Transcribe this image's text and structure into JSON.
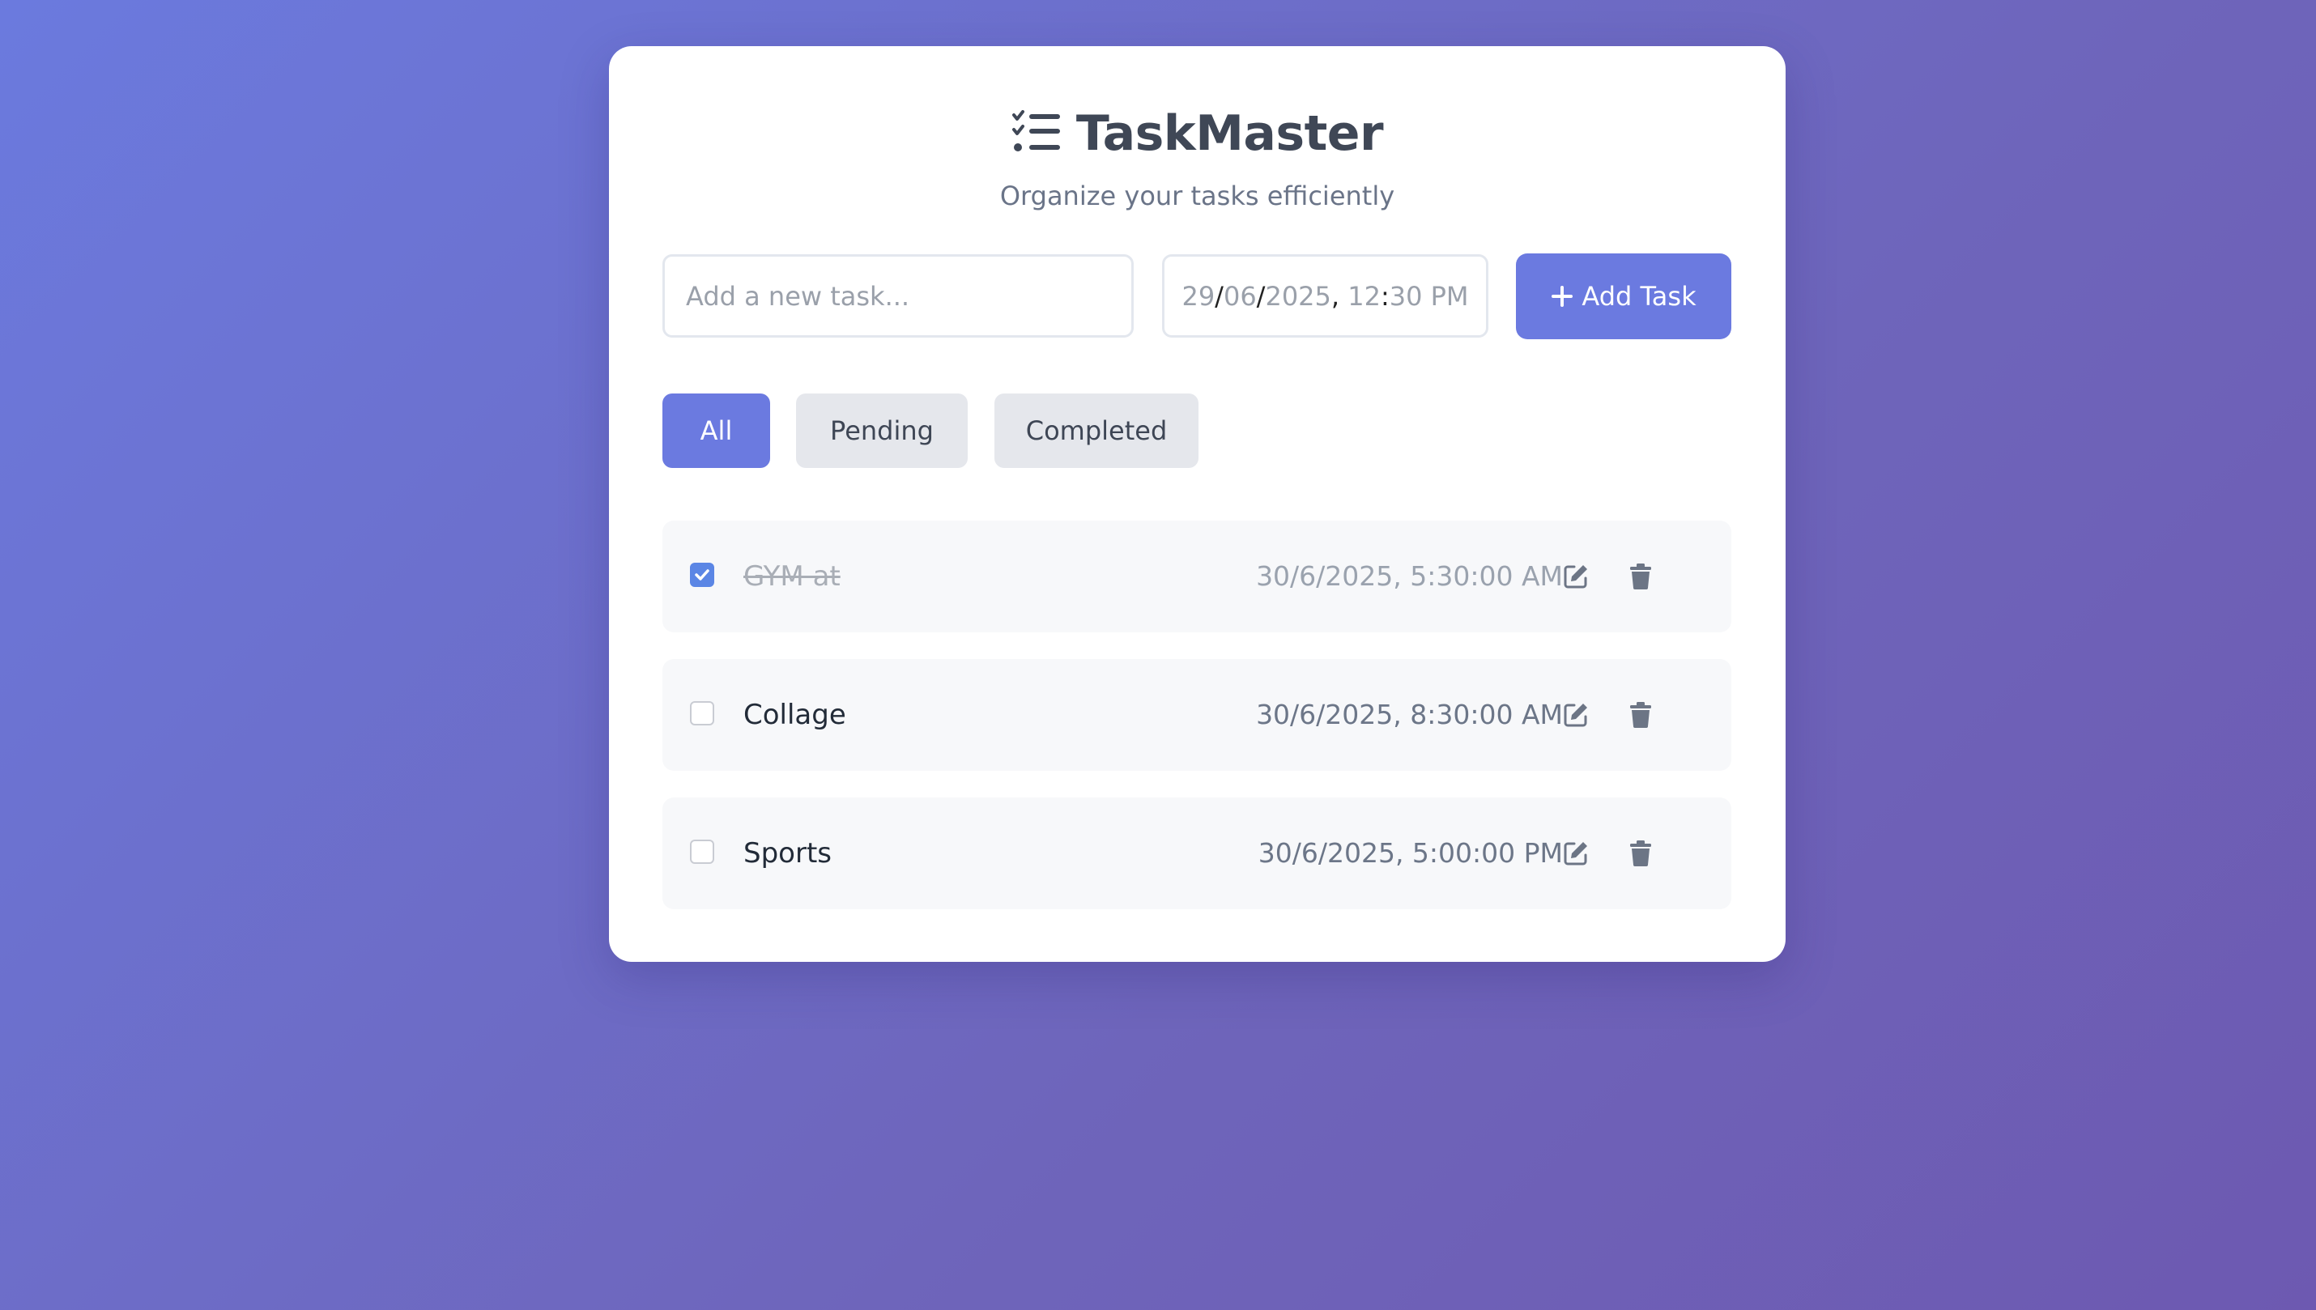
{
  "app": {
    "title": "TaskMaster",
    "subtitle": "Organize your tasks efficiently",
    "icon": "tasks-list-icon"
  },
  "form": {
    "task_placeholder": "Add a new task...",
    "task_value": "",
    "datetime": {
      "day": "29",
      "month": "06",
      "year": "2025",
      "hour": "12",
      "minute": "30",
      "period": "PM"
    },
    "add_label": "Add Task"
  },
  "filters": {
    "all": "All",
    "pending": "Pending",
    "completed": "Completed",
    "active": "All"
  },
  "tasks": [
    {
      "text": "GYM at",
      "datetime": "30/6/2025, 5:30:00 AM",
      "completed": true
    },
    {
      "text": "Collage",
      "datetime": "30/6/2025, 8:30:00 AM",
      "completed": false
    },
    {
      "text": "Sports",
      "datetime": "30/6/2025, 5:00:00 PM",
      "completed": false
    }
  ],
  "icons": {
    "edit": "edit-icon",
    "delete": "trash-icon",
    "add": "plus-icon",
    "check": "check-icon"
  },
  "colors": {
    "accent": "#6b7ae0",
    "checkbox_checked": "#5b86e5",
    "card_bg": "#ffffff",
    "row_bg": "#f7f8fa",
    "filter_inactive_bg": "#e5e7ec",
    "icon_gray": "#6c7585"
  }
}
